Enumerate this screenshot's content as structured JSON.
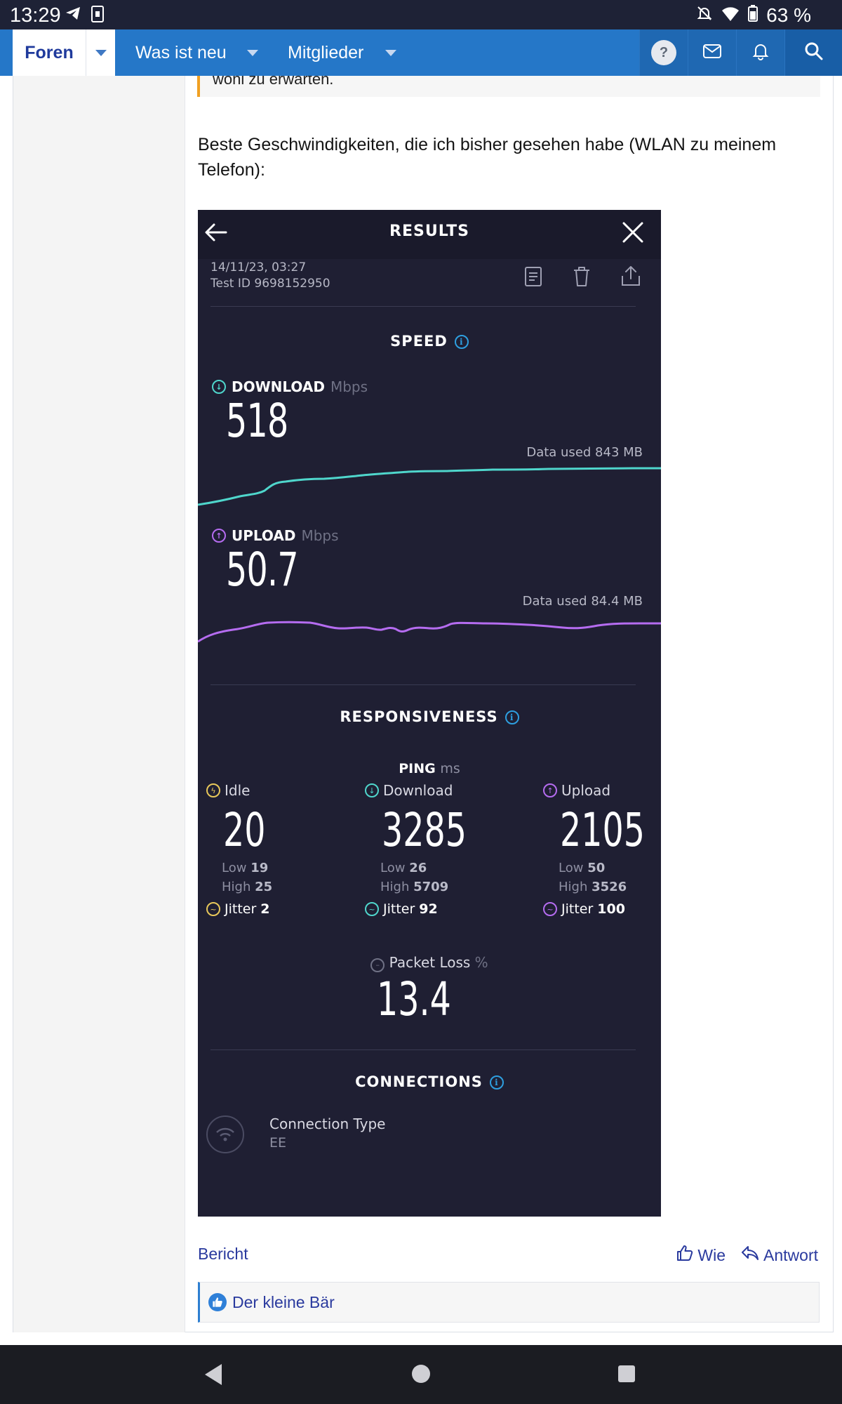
{
  "status_bar": {
    "time": "13:29",
    "battery": "63 %",
    "icons": [
      "telegram-icon",
      "sim-icon",
      "mute-icon",
      "wifi-icon",
      "battery-icon"
    ]
  },
  "nav": {
    "forums": "Foren",
    "whats_new": "Was ist neu",
    "members": "Mitglieder",
    "help_symbol": "?",
    "tools": [
      "help-icon",
      "inbox-icon",
      "bell-icon",
      "search-icon"
    ]
  },
  "post": {
    "quote_tail": "wohl zu erwarten.",
    "text": "Beste Geschwindigkeiten, die ich bisher gesehen habe (WLAN zu meinem Telefon):",
    "report": "Bericht",
    "like": "Wie",
    "reply": "Antwort",
    "reaction_user": "Der kleine Bär"
  },
  "speedtest": {
    "title": "RESULTS",
    "date": "14/11/23, 03:27",
    "test_id": "Test ID 9698152950",
    "speed_section": "SPEED",
    "download_label": "DOWNLOAD",
    "upload_label": "UPLOAD",
    "unit_mbps": "Mbps",
    "download_value": "518",
    "upload_value": "50.7",
    "download_data_used": "Data used 843 MB",
    "upload_data_used": "Data used 84.4 MB",
    "responsiveness_section": "RESPONSIVENESS",
    "ping_label": "PING",
    "ping_unit": "ms",
    "low_label": "Low",
    "high_label": "High",
    "jitter_label": "Jitter",
    "ping": {
      "idle": {
        "label": "Idle",
        "value": "20",
        "low": "19",
        "high": "25",
        "jitter": "2",
        "color": "#e8c85a"
      },
      "download": {
        "label": "Download",
        "value": "3285",
        "low": "26",
        "high": "5709",
        "jitter": "92",
        "color": "#4fd6cc"
      },
      "upload": {
        "label": "Upload",
        "value": "2105",
        "low": "50",
        "high": "3526",
        "jitter": "100",
        "color": "#b56cf0"
      }
    },
    "packet_loss_label": "Packet Loss",
    "packet_loss_unit": "%",
    "packet_loss_value": "13.4",
    "connections_section": "CONNECTIONS",
    "connection_type_label": "Connection Type",
    "connection_type_value": "EE",
    "colors": {
      "download": "#4fd6cc",
      "upload": "#b56cf0",
      "info": "#2e9fe0",
      "background": "#1f1f33"
    }
  }
}
